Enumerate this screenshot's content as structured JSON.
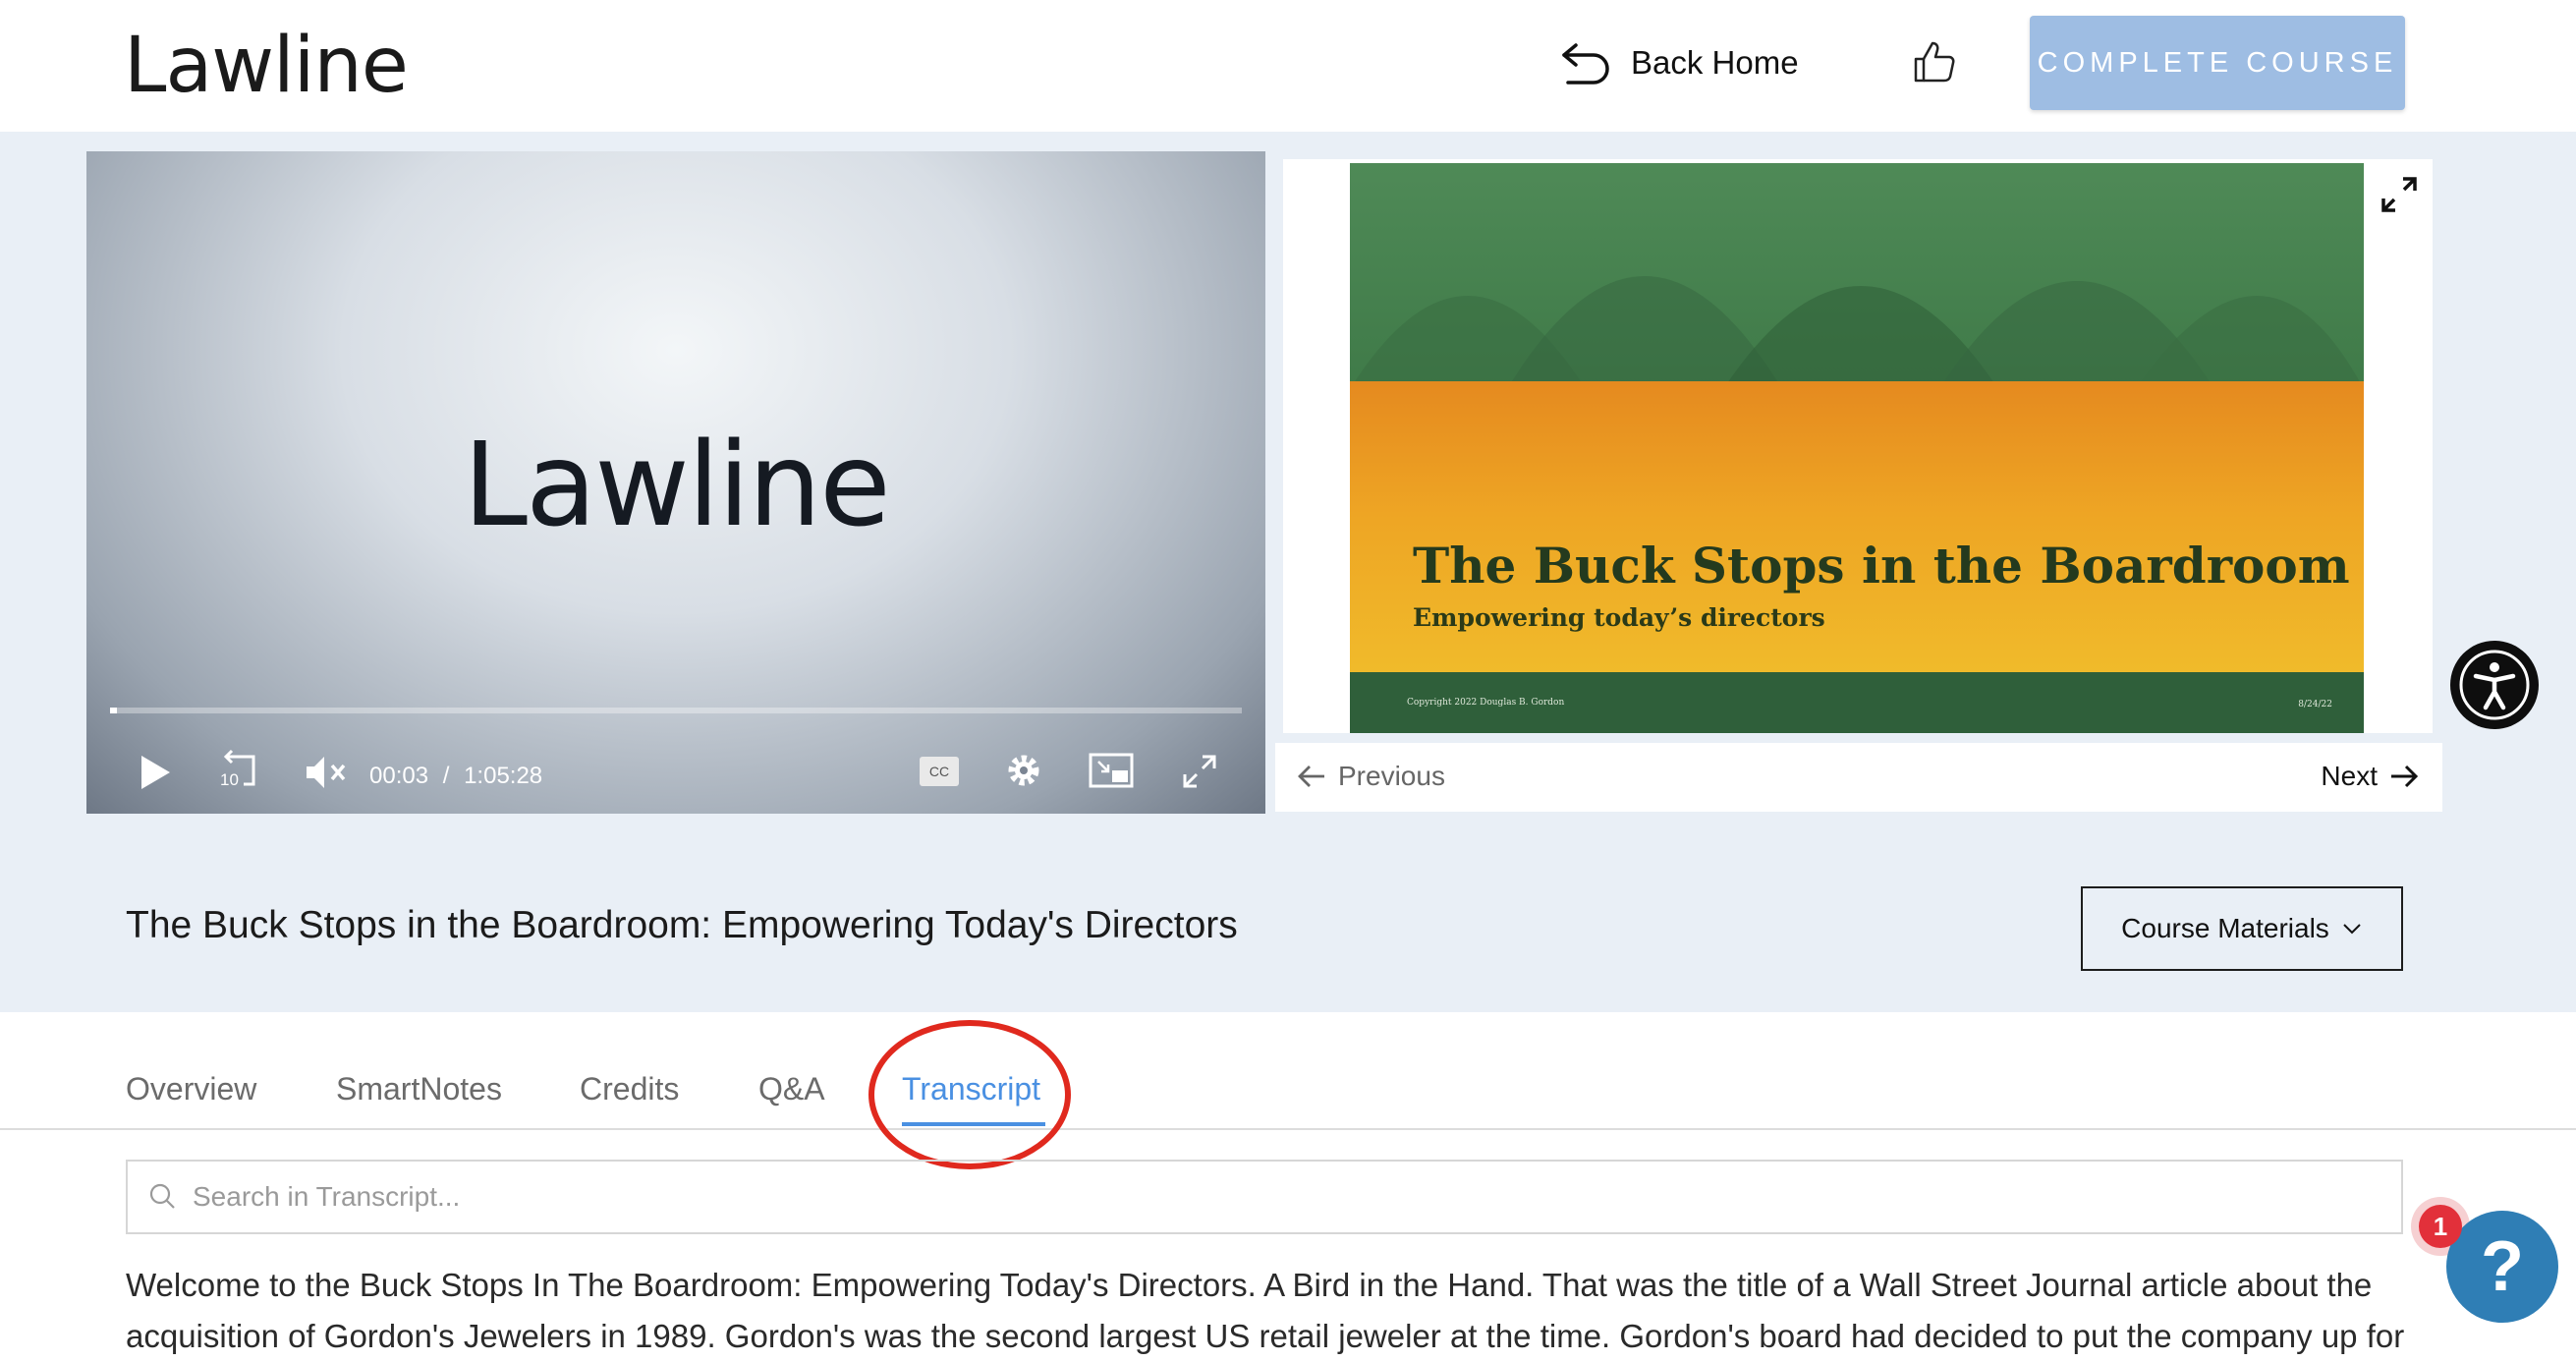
{
  "header": {
    "logo": "Lawline",
    "back_home": "Back Home",
    "complete_course": "COMPLETE COURSE"
  },
  "video": {
    "logo": "Lawline",
    "current_time": "00:03",
    "separator": "/",
    "duration": "1:05:28",
    "cc_label": "CC",
    "rewind_label": "10",
    "progress": 0.006
  },
  "slide": {
    "title": "The Buck Stops in the Boardroom",
    "subtitle": "Empowering today’s directors",
    "copyright": "Copyright 2022 Douglas B. Gordon",
    "date": "8/24/22",
    "prev_label": "Previous",
    "next_label": "Next"
  },
  "course": {
    "title": "The Buck Stops in the Boardroom: Empowering Today's Directors",
    "materials_label": "Course Materials"
  },
  "tabs": [
    {
      "label": "Overview",
      "active": false
    },
    {
      "label": "SmartNotes",
      "active": false
    },
    {
      "label": "Credits",
      "active": false
    },
    {
      "label": "Q&A",
      "active": false
    },
    {
      "label": "Transcript",
      "active": true
    }
  ],
  "search": {
    "placeholder": "Search in Transcript..."
  },
  "transcript": {
    "line1": "Welcome to the Buck Stops In The Boardroom: Empowering Today's Directors. A Bird in the Hand. That was the title of a Wall Street Journal article about the",
    "line2": "acquisition of Gordon's Jewelers in 1989. Gordon's was the second largest US retail jeweler at the time. Gordon's board had decided to put the company up for"
  },
  "help": {
    "badge_count": "1",
    "icon_glyph": "?"
  },
  "colors": {
    "accent_blue": "#4a90e2",
    "complete_btn": "#9ebde3",
    "band_bg": "#e9eff6",
    "annotation_red": "#e0291e"
  }
}
